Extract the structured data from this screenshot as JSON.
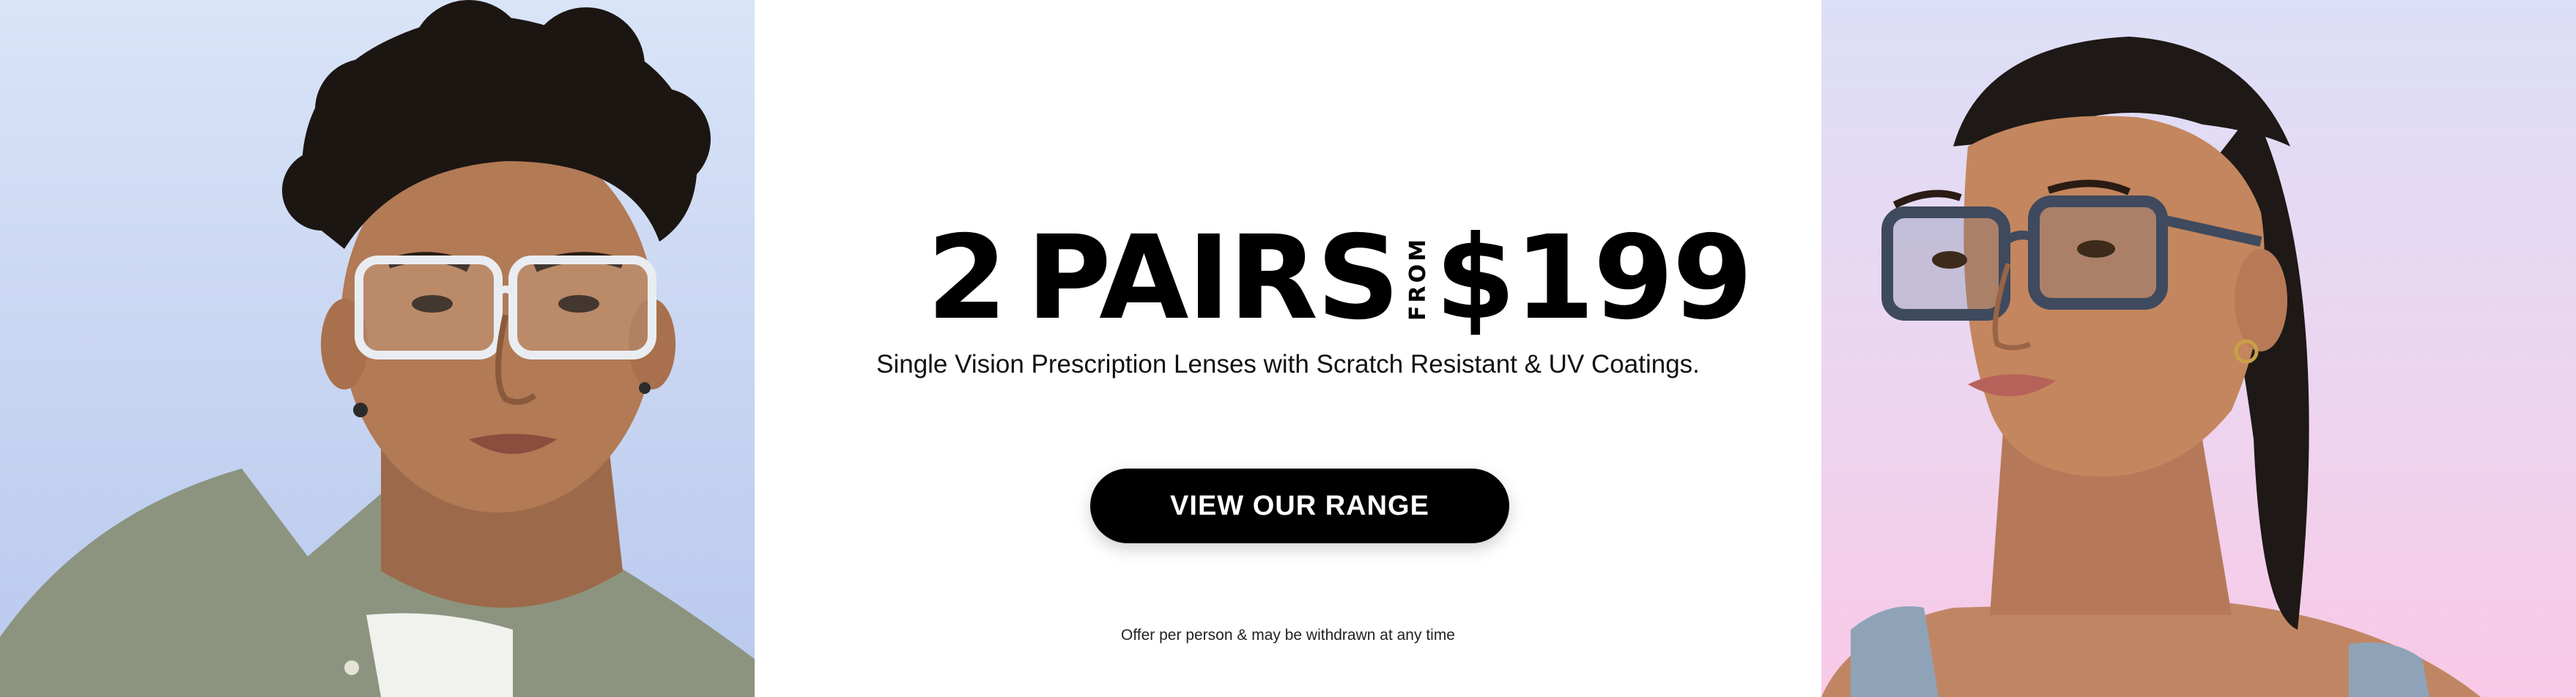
{
  "promo": {
    "count": "2",
    "pairs": "PAIRS",
    "from": "FROM",
    "price": "$199",
    "subtitle": "Single Vision Prescription Lenses with Scratch Resistant & UV Coatings.",
    "cta_label": "VIEW OUR RANGE",
    "disclaimer": "Offer per person & may be withdrawn at any time"
  },
  "colors": {
    "left_panel": "#c9d6f2",
    "right_panel": "#f8c9e6",
    "button": "#000000",
    "button_text": "#ffffff"
  }
}
